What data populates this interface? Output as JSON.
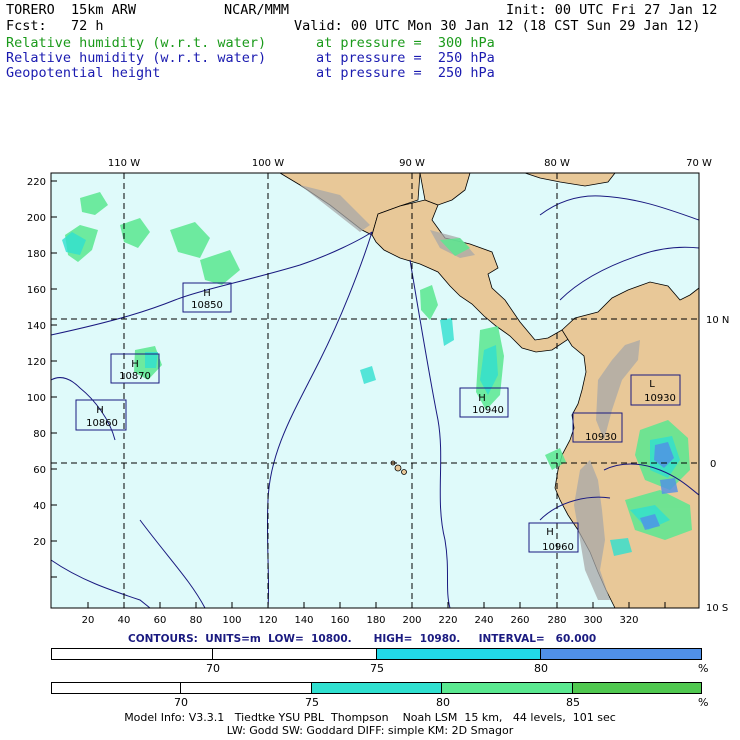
{
  "header": {
    "model": "TORERO  15km ARW",
    "org": "NCAR/MMM",
    "init": "Init: 00 UTC Fri 27 Jan 12",
    "fcst": "Fcst:   72 h",
    "valid": "Valid: 00 UTC Mon 30 Jan 12 (18 CST Sun 29 Jan 12)",
    "fields": [
      {
        "name": "Relative humidity (w.r.t. water)",
        "level": "at pressure =  300 hPa",
        "color": "#1a9a1a"
      },
      {
        "name": "Relative humidity (w.r.t. water)",
        "level": "at pressure =  250 hPa",
        "color": "#1a1ab0"
      },
      {
        "name": "Geopotential height",
        "level": "at pressure =  250 hPa",
        "color": "#1a1ab0"
      }
    ]
  },
  "map": {
    "top_lon_labels": [
      "110 W",
      "100 W",
      "90 W",
      "80 W",
      "70 W"
    ],
    "right_lat_labels": [
      "10 N",
      "0",
      "10 S"
    ],
    "y_ticks": [
      "220",
      "200",
      "180",
      "160",
      "140",
      "120",
      "100",
      "80",
      "60",
      "40",
      "20"
    ],
    "x_ticks": [
      "20",
      "40",
      "60",
      "80",
      "100",
      "120",
      "140",
      "160",
      "180",
      "200",
      "220",
      "240",
      "260",
      "280",
      "300",
      "320"
    ],
    "ocean_color": "#dffafa",
    "land_color": "#e8c898",
    "pressure_centers": [
      {
        "type": "H",
        "value": "10850"
      },
      {
        "type": "H",
        "value": "10870"
      },
      {
        "type": "H",
        "value": "10860"
      },
      {
        "type": "H",
        "value": "10940"
      },
      {
        "type": "",
        "value": "10930"
      },
      {
        "type": "L",
        "value": "10930"
      },
      {
        "type": "H",
        "value": "10960"
      }
    ]
  },
  "contours": {
    "label": "CONTOURS:  UNITS=m  LOW=  10800.      HIGH=  10980.     INTERVAL=   60.000"
  },
  "colorbar1": {
    "labels": [
      "70",
      "75",
      "80",
      "%"
    ],
    "colors": [
      "#ffffff",
      "#ffffff",
      "#22d8e8",
      "#5090e8"
    ]
  },
  "colorbar2": {
    "labels": [
      "70",
      "75",
      "80",
      "85",
      "%"
    ],
    "colors": [
      "#ffffff",
      "#ffffff",
      "#30e0d0",
      "#5ae890",
      "#50c850"
    ]
  },
  "footer": {
    "line1": "Model Info: V3.3.1   Tiedtke YSU PBL  Thompson    Noah LSM  15 km,   44 levels,  101 sec",
    "line2": "LW: Godd SW: Goddard DIFF: simple KM: 2D Smagor"
  }
}
